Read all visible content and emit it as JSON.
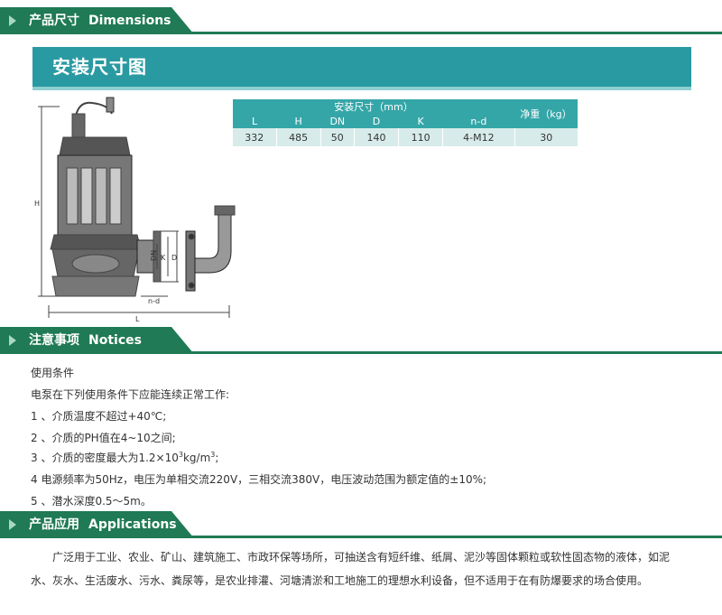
{
  "sections": {
    "dimensions": {
      "zh": "产品尺寸",
      "en": "Dimensions"
    },
    "notices": {
      "zh": "注意事项",
      "en": "Notices"
    },
    "applications": {
      "zh": "产品应用",
      "en": "Applications"
    }
  },
  "install_title": "安装尺寸图",
  "diagram_labels": {
    "h": "H",
    "l": "L",
    "dn": "DN",
    "k": "K",
    "d": "D",
    "nd": "n-d"
  },
  "table": {
    "group_header": "安装尺寸（mm）",
    "weight_header": "净重（kg）",
    "columns": [
      "L",
      "H",
      "DN",
      "D",
      "K",
      "n-d"
    ],
    "values": [
      "332",
      "485",
      "50",
      "140",
      "110",
      "4-M12",
      "30"
    ]
  },
  "notices": {
    "heading": "使用条件",
    "intro": "电泵在下列使用条件下应能连续正常工作:",
    "item1": "1 、介质温度不超过+40℃;",
    "item2": "2 、介质的PH值在4~10之间;",
    "item3_pre": "3 、介质的密度最大为1.2×10",
    "item3_sup1": "3",
    "item3_mid": "kg/m",
    "item3_sup2": "3",
    "item3_post": ";",
    "item4": "4 电源频率为50Hz，电压为单相交流220V，三相交流380V，电压波动范围为额定值的±10%;",
    "item5": "5 、潜水深度0.5～5m。"
  },
  "application_text": "广泛用于工业、农业、矿山、建筑施工、市政环保等场所，可抽送含有短纤维、纸屑、泥沙等固体颗粒或软性固态物的液体，如泥水、灰水、生活废水、污水、粪尿等，是农业排灌、河塘清淤和工地施工的理想水利设备，但不适用于在有防爆要求的场合使用。",
  "colors": {
    "section_green": "#1f7a55",
    "title_teal": "#2a9aa2",
    "table_header": "#34a6a8",
    "table_cell": "#d7ecea"
  }
}
